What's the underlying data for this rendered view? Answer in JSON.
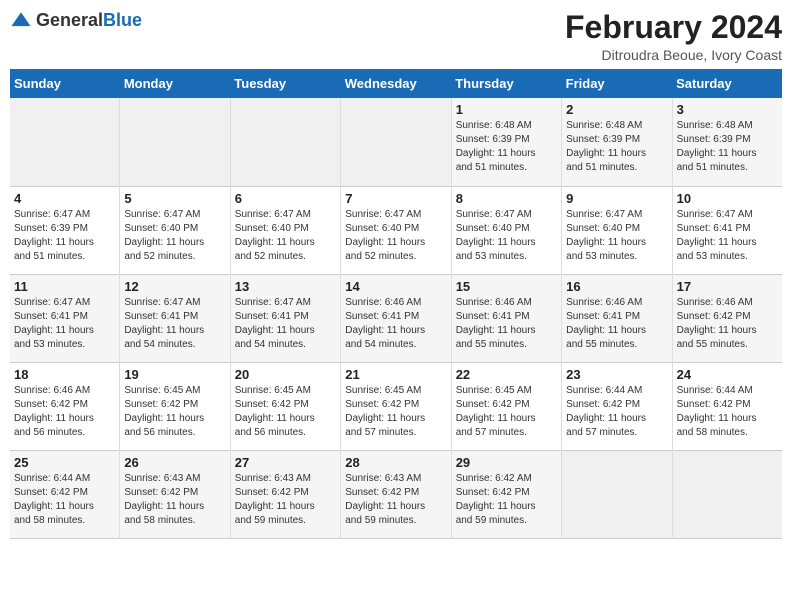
{
  "logo": {
    "text_general": "General",
    "text_blue": "Blue"
  },
  "header": {
    "title": "February 2024",
    "subtitle": "Ditroudra Beoue, Ivory Coast"
  },
  "days_of_week": [
    "Sunday",
    "Monday",
    "Tuesday",
    "Wednesday",
    "Thursday",
    "Friday",
    "Saturday"
  ],
  "weeks": [
    [
      {
        "day": "",
        "info": "",
        "empty": true
      },
      {
        "day": "",
        "info": "",
        "empty": true
      },
      {
        "day": "",
        "info": "",
        "empty": true
      },
      {
        "day": "",
        "info": "",
        "empty": true
      },
      {
        "day": "1",
        "info": "Sunrise: 6:48 AM\nSunset: 6:39 PM\nDaylight: 11 hours\nand 51 minutes.",
        "empty": false
      },
      {
        "day": "2",
        "info": "Sunrise: 6:48 AM\nSunset: 6:39 PM\nDaylight: 11 hours\nand 51 minutes.",
        "empty": false
      },
      {
        "day": "3",
        "info": "Sunrise: 6:48 AM\nSunset: 6:39 PM\nDaylight: 11 hours\nand 51 minutes.",
        "empty": false
      }
    ],
    [
      {
        "day": "4",
        "info": "Sunrise: 6:47 AM\nSunset: 6:39 PM\nDaylight: 11 hours\nand 51 minutes.",
        "empty": false
      },
      {
        "day": "5",
        "info": "Sunrise: 6:47 AM\nSunset: 6:40 PM\nDaylight: 11 hours\nand 52 minutes.",
        "empty": false
      },
      {
        "day": "6",
        "info": "Sunrise: 6:47 AM\nSunset: 6:40 PM\nDaylight: 11 hours\nand 52 minutes.",
        "empty": false
      },
      {
        "day": "7",
        "info": "Sunrise: 6:47 AM\nSunset: 6:40 PM\nDaylight: 11 hours\nand 52 minutes.",
        "empty": false
      },
      {
        "day": "8",
        "info": "Sunrise: 6:47 AM\nSunset: 6:40 PM\nDaylight: 11 hours\nand 53 minutes.",
        "empty": false
      },
      {
        "day": "9",
        "info": "Sunrise: 6:47 AM\nSunset: 6:40 PM\nDaylight: 11 hours\nand 53 minutes.",
        "empty": false
      },
      {
        "day": "10",
        "info": "Sunrise: 6:47 AM\nSunset: 6:41 PM\nDaylight: 11 hours\nand 53 minutes.",
        "empty": false
      }
    ],
    [
      {
        "day": "11",
        "info": "Sunrise: 6:47 AM\nSunset: 6:41 PM\nDaylight: 11 hours\nand 53 minutes.",
        "empty": false
      },
      {
        "day": "12",
        "info": "Sunrise: 6:47 AM\nSunset: 6:41 PM\nDaylight: 11 hours\nand 54 minutes.",
        "empty": false
      },
      {
        "day": "13",
        "info": "Sunrise: 6:47 AM\nSunset: 6:41 PM\nDaylight: 11 hours\nand 54 minutes.",
        "empty": false
      },
      {
        "day": "14",
        "info": "Sunrise: 6:46 AM\nSunset: 6:41 PM\nDaylight: 11 hours\nand 54 minutes.",
        "empty": false
      },
      {
        "day": "15",
        "info": "Sunrise: 6:46 AM\nSunset: 6:41 PM\nDaylight: 11 hours\nand 55 minutes.",
        "empty": false
      },
      {
        "day": "16",
        "info": "Sunrise: 6:46 AM\nSunset: 6:41 PM\nDaylight: 11 hours\nand 55 minutes.",
        "empty": false
      },
      {
        "day": "17",
        "info": "Sunrise: 6:46 AM\nSunset: 6:42 PM\nDaylight: 11 hours\nand 55 minutes.",
        "empty": false
      }
    ],
    [
      {
        "day": "18",
        "info": "Sunrise: 6:46 AM\nSunset: 6:42 PM\nDaylight: 11 hours\nand 56 minutes.",
        "empty": false
      },
      {
        "day": "19",
        "info": "Sunrise: 6:45 AM\nSunset: 6:42 PM\nDaylight: 11 hours\nand 56 minutes.",
        "empty": false
      },
      {
        "day": "20",
        "info": "Sunrise: 6:45 AM\nSunset: 6:42 PM\nDaylight: 11 hours\nand 56 minutes.",
        "empty": false
      },
      {
        "day": "21",
        "info": "Sunrise: 6:45 AM\nSunset: 6:42 PM\nDaylight: 11 hours\nand 57 minutes.",
        "empty": false
      },
      {
        "day": "22",
        "info": "Sunrise: 6:45 AM\nSunset: 6:42 PM\nDaylight: 11 hours\nand 57 minutes.",
        "empty": false
      },
      {
        "day": "23",
        "info": "Sunrise: 6:44 AM\nSunset: 6:42 PM\nDaylight: 11 hours\nand 57 minutes.",
        "empty": false
      },
      {
        "day": "24",
        "info": "Sunrise: 6:44 AM\nSunset: 6:42 PM\nDaylight: 11 hours\nand 58 minutes.",
        "empty": false
      }
    ],
    [
      {
        "day": "25",
        "info": "Sunrise: 6:44 AM\nSunset: 6:42 PM\nDaylight: 11 hours\nand 58 minutes.",
        "empty": false
      },
      {
        "day": "26",
        "info": "Sunrise: 6:43 AM\nSunset: 6:42 PM\nDaylight: 11 hours\nand 58 minutes.",
        "empty": false
      },
      {
        "day": "27",
        "info": "Sunrise: 6:43 AM\nSunset: 6:42 PM\nDaylight: 11 hours\nand 59 minutes.",
        "empty": false
      },
      {
        "day": "28",
        "info": "Sunrise: 6:43 AM\nSunset: 6:42 PM\nDaylight: 11 hours\nand 59 minutes.",
        "empty": false
      },
      {
        "day": "29",
        "info": "Sunrise: 6:42 AM\nSunset: 6:42 PM\nDaylight: 11 hours\nand 59 minutes.",
        "empty": false
      },
      {
        "day": "",
        "info": "",
        "empty": true
      },
      {
        "day": "",
        "info": "",
        "empty": true
      }
    ]
  ]
}
